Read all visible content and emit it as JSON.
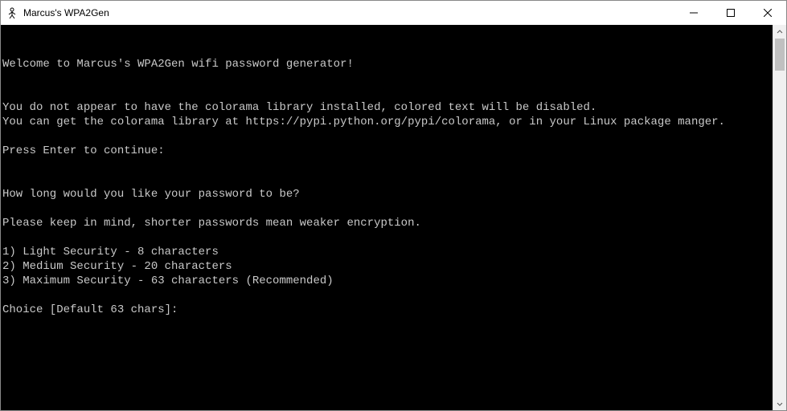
{
  "window": {
    "title": "Marcus's WPA2Gen"
  },
  "terminal": {
    "lines": [
      "",
      "",
      "Welcome to Marcus's WPA2Gen wifi password generator!",
      "",
      "",
      "You do not appear to have the colorama library installed, colored text will be disabled.",
      "You can get the colorama library at https://pypi.python.org/pypi/colorama, or in your Linux package manger.",
      "",
      "Press Enter to continue:",
      "",
      "",
      "How long would you like your password to be?",
      "",
      "Please keep in mind, shorter passwords mean weaker encryption.",
      "",
      "1) Light Security - 8 characters",
      "2) Medium Security - 20 characters",
      "3) Maximum Security - 63 characters (Recommended)",
      "",
      "Choice [Default 63 chars]:"
    ]
  }
}
